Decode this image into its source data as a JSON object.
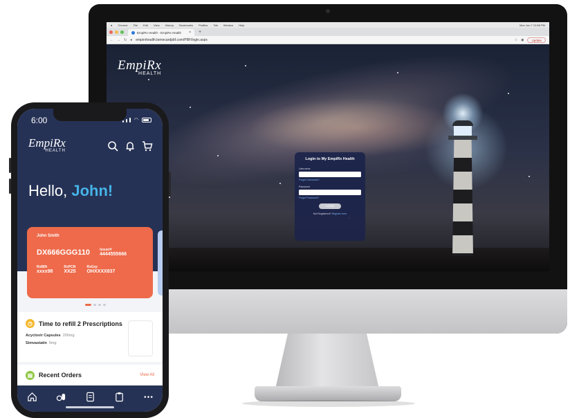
{
  "desktop": {
    "menubar": [
      "Chrome",
      "File",
      "Edit",
      "View",
      "History",
      "Bookmarks",
      "Profiles",
      "Tab",
      "Window",
      "Help"
    ],
    "clock": "Mon Jun 7 12:58 PM",
    "tab_title": "EmpiRx Health - EmpiRx Health",
    "url": "empirxhealth.benecardpbf.com/PBF/login.aspx",
    "update_label": "Update",
    "logo": {
      "main": "EmpiRx",
      "sub": "HEALTH"
    },
    "login": {
      "title": "Login to My EmpiRx Health",
      "username_label": "Username",
      "forgot_username": "Forgot Username?",
      "password_label": "Password",
      "forgot_password": "Forgot Password?",
      "login_button": "LOGIN",
      "not_registered": "Not Registered?",
      "register_link": "Register here"
    }
  },
  "phone": {
    "time": "6:00",
    "logo": {
      "main": "EmpiRx",
      "sub": "HEALTH"
    },
    "greeting": "Hello,",
    "user_name": "John!",
    "card": {
      "member_name": "John Smith",
      "member_id": "DX666GGG110",
      "issuer_label": "Issuer#",
      "issuer": "4444555666",
      "rxbin_label": "RxBIN",
      "rxbin": "xxxx98",
      "rxpcn_label": "RxPCN",
      "rxpcn": "XX25",
      "rxgrp_label": "RxGrp",
      "rxgrp": "OHXXXX837"
    },
    "refill_title": "Time to refill 2 Prescriptions",
    "prescriptions": [
      {
        "name": "Acyclovir Capsules",
        "dose": "200mg"
      },
      {
        "name": "Simvastatin",
        "dose": "5mg"
      }
    ],
    "recent_orders": "Recent Orders",
    "view_all": "View All"
  },
  "colors": {
    "navy": "#263255",
    "card_orange": "#ee6a4a",
    "accent_blue": "#46b3e8"
  }
}
